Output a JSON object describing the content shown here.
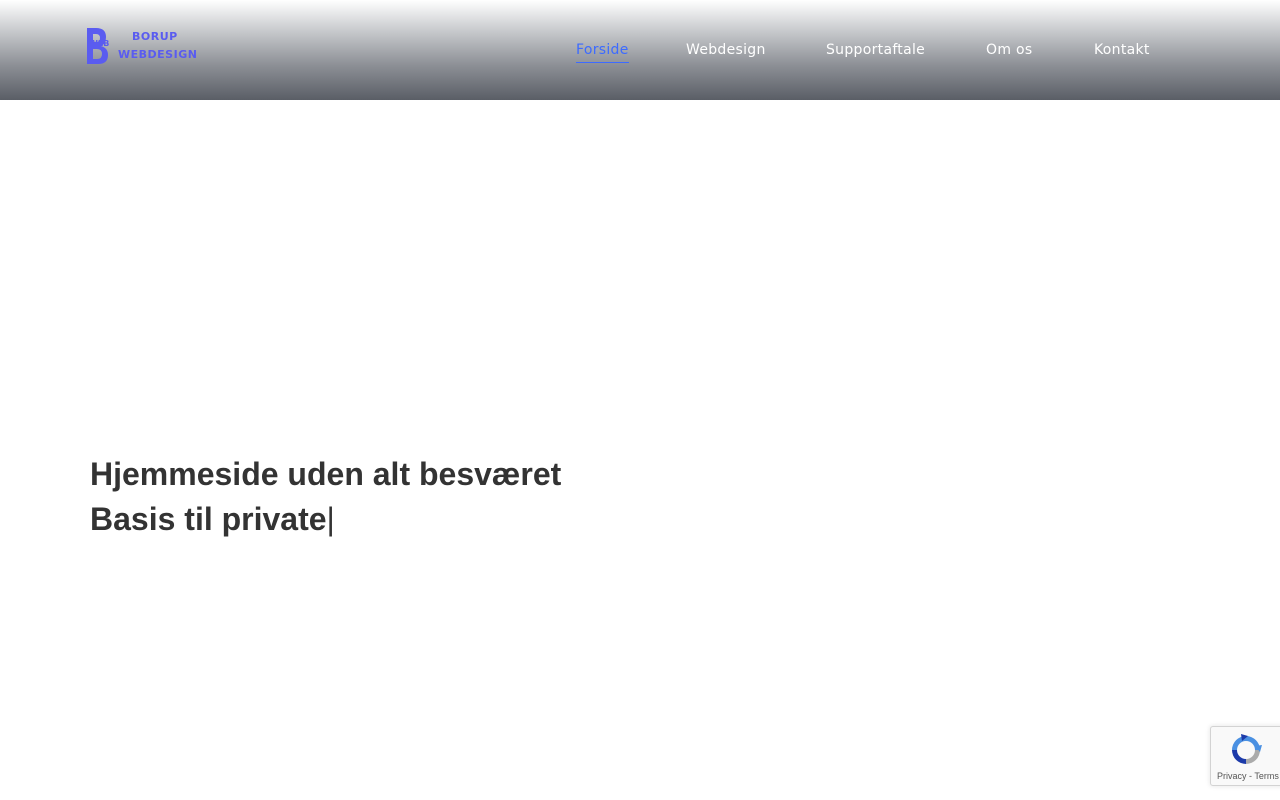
{
  "brand": {
    "logo_web": "WEB",
    "logo_line1": "BORUP",
    "logo_line2": "WEBDESIGN",
    "logo_icon": "b-logo-icon",
    "color": "#5a5cf0"
  },
  "nav": {
    "items": [
      {
        "label": "Forside",
        "active": true
      },
      {
        "label": "Webdesign",
        "active": false
      },
      {
        "label": "Supportaftale",
        "active": false
      },
      {
        "label": "Om os",
        "active": false
      },
      {
        "label": "Kontakt",
        "active": false
      }
    ],
    "active_color": "#3d6bff"
  },
  "hero": {
    "line1": "Hjemmeside uden alt besværet",
    "line2": "Basis til private",
    "cursor": "|"
  },
  "recaptcha": {
    "icon": "recaptcha-icon",
    "privacy": "Privacy",
    "separator": " - ",
    "terms": "Terms"
  }
}
